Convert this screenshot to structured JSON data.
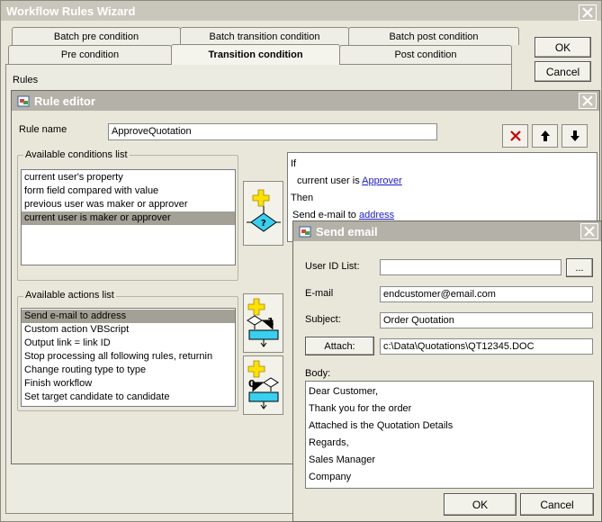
{
  "wizard": {
    "title": "Workflow Rules Wizard",
    "ok_label": "OK",
    "cancel_label": "Cancel",
    "tabs_top": [
      "Batch pre condition",
      "Batch transition condition",
      "Batch post condition"
    ],
    "tabs_bottom": [
      "Pre condition",
      "Transition condition",
      "Post condition"
    ],
    "selected_tab": "Transition condition",
    "rules_label": "Rules"
  },
  "rule_editor": {
    "title": "Rule editor",
    "rule_name_label": "Rule name",
    "rule_name_value": "ApproveQuotation",
    "conditions_title": "Available conditions list",
    "conditions": [
      "current user's property",
      "form field compared with value",
      "previous user was maker or approver",
      "current user is maker or approver"
    ],
    "selected_condition_index": 3,
    "actions_title": "Available actions list",
    "actions": [
      "Send e-mail to address",
      "Custom action VBScript",
      "Output link = link ID",
      "Stop processing all following rules, returnin",
      "Change routing type to type",
      "Finish workflow",
      "Set target candidate to candidate"
    ],
    "selected_action_index": 0,
    "rule_text": {
      "if": "If",
      "condition_prefix": "current user is",
      "condition_link": "Approver",
      "then": "Then",
      "action_prefix": "Send e-mail to",
      "action_link": "address"
    },
    "add_action_labels": [
      "1",
      "0"
    ]
  },
  "send_email": {
    "title": "Send email",
    "user_id_label": "User ID List:",
    "user_id_value": "",
    "browse_label": "...",
    "email_label": "E-mail",
    "email_value": "endcustomer@email.com",
    "subject_label": "Subject:",
    "subject_value": "Order Quotation",
    "attach_label": "Attach:",
    "attach_value": "c:\\Data\\Quotations\\QT12345.DOC",
    "body_label": "Body:",
    "body_lines": [
      "Dear Customer,",
      "Thank you for the order",
      "Attached is the Quotation Details",
      "Regards,",
      "Sales Manager",
      "Company"
    ],
    "ok_label": "OK",
    "cancel_label": "Cancel"
  },
  "colors": {
    "dialog_bg": "#e9e7d9",
    "selection": "#a3a195",
    "link": "#1a1ad6",
    "delete_x": "#cc0000",
    "plus": "#ffe000",
    "diamond": "#38d0f0"
  }
}
